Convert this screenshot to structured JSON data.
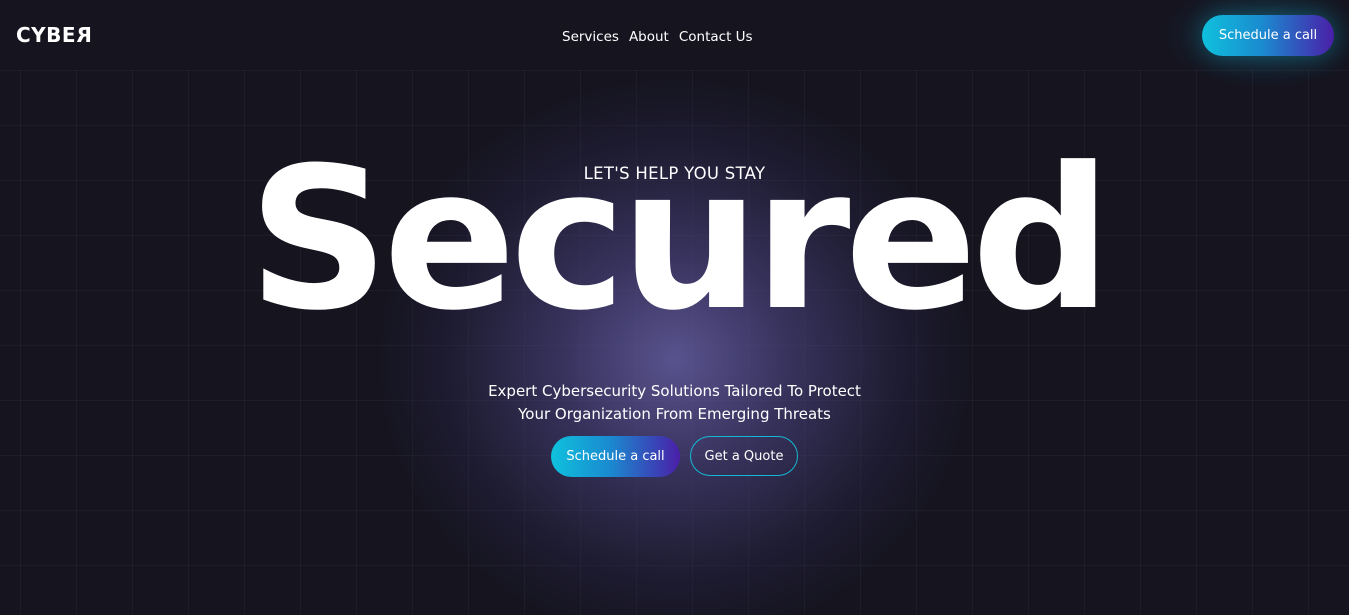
{
  "header": {
    "logo_main": "CYBE",
    "logo_last": "R",
    "nav": [
      {
        "label": "Services"
      },
      {
        "label": "About"
      },
      {
        "label": "Contact Us"
      }
    ],
    "cta_label": "Schedule a call"
  },
  "hero": {
    "eyebrow": "LET'S HELP YOU STAY",
    "headline": "Secured",
    "subtitle_line1": "Expert Cybersecurity Solutions Tailored To Protect",
    "subtitle_line2": "Your Organization From Emerging Threats",
    "primary_cta": "Schedule a call",
    "secondary_cta": "Get a Quote"
  },
  "colors": {
    "background": "#15141f",
    "accent_cyan": "#0fc1dc",
    "accent_purple": "#4a1fa8",
    "glow": "#6a62aa"
  }
}
